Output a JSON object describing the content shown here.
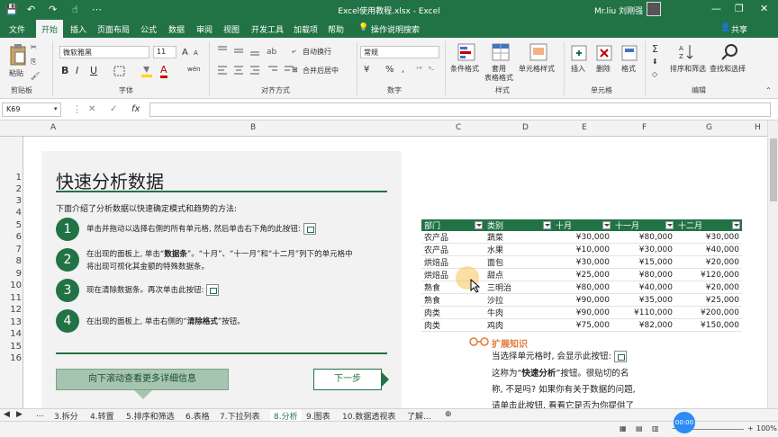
{
  "window": {
    "title": "Excel使用教程.xlsx - Excel",
    "user": "Mr.liu 刘刚强",
    "minimize": "—",
    "restore": "❐",
    "close": "✕"
  },
  "ribbon_tabs": [
    "文件",
    "开始",
    "插入",
    "页面布局",
    "公式",
    "数据",
    "审阅",
    "视图",
    "开发工具",
    "加载项",
    "帮助",
    "操作说明搜索"
  ],
  "ribbon": {
    "clipboard": {
      "paste": "粘贴",
      "label": "剪贴板"
    },
    "font": {
      "name": "微软雅黑",
      "size": "11",
      "label": "字体",
      "bold": "B",
      "italic": "I",
      "underline": "U",
      "grow": "A",
      "shrink": "A",
      "fontcolor": "A",
      "wen": "wén"
    },
    "alignment": {
      "wrap": "自动换行",
      "merge": "合并后居中",
      "label": "对齐方式"
    },
    "number": {
      "format": "常规",
      "label": "数字",
      "percent": "%",
      "comma": ",",
      "currency": "¥"
    },
    "styles": {
      "conditional": "条件格式",
      "table": "套用\n表格格式",
      "cell_styles": "单元格样式",
      "label": "样式"
    },
    "cells": {
      "insert": "插入",
      "delete": "删除",
      "format": "格式",
      "label": "单元格"
    },
    "editing": {
      "sort": "排序和筛选",
      "find": "查找和选择",
      "label": "编辑",
      "sum": "Σ"
    }
  },
  "formula_bar": {
    "namebox": "K69",
    "fx": "fx",
    "cancel": "✕",
    "enter": "✓",
    "value": ""
  },
  "columns": [
    "A",
    "B",
    "C",
    "D",
    "E",
    "F",
    "G",
    "H"
  ],
  "rows": [
    "1",
    "2",
    "3",
    "4",
    "5",
    "6",
    "7",
    "8",
    "9",
    "10",
    "11",
    "12",
    "13",
    "14",
    "15",
    "16"
  ],
  "panel": {
    "title": "快速分析数据",
    "intro": "下面介绍了分析数据以快速确定模式和趋势的方法:",
    "steps": [
      {
        "num": "1",
        "text": "单击并拖动以选择右侧的所有单元格, 然后单击右下角的此按钮:"
      },
      {
        "num": "2",
        "pre": "在出现的面板上, 单击“",
        "bold": "数据条",
        "post": "”。“十月”、“十一月”和“十二月”列下的单元格中将出现可视化其金额的特殊数据条。"
      },
      {
        "num": "3",
        "text": "现在清除数据条。再次单击此按钮:"
      },
      {
        "num": "4",
        "pre": "在出现的面板上, 单击右侧的“",
        "bold": "清除格式",
        "post": "”按钮。"
      }
    ],
    "scroll_button": "向下滚动查看更多详细信息",
    "next_button": "下一步"
  },
  "table": {
    "headers": [
      "部门",
      "类别",
      "十月",
      "十一月",
      "十二月"
    ],
    "rows": [
      [
        "农产品",
        "蔬菜",
        "¥30,000",
        "¥80,000",
        "¥30,000"
      ],
      [
        "农产品",
        "水果",
        "¥10,000",
        "¥30,000",
        "¥40,000"
      ],
      [
        "烘焙品",
        "面包",
        "¥30,000",
        "¥15,000",
        "¥20,000"
      ],
      [
        "烘焙品",
        "甜点",
        "¥25,000",
        "¥80,000",
        "¥120,000"
      ],
      [
        "熟食",
        "三明治",
        "¥80,000",
        "¥40,000",
        "¥20,000"
      ],
      [
        "熟食",
        "沙拉",
        "¥90,000",
        "¥35,000",
        "¥25,000"
      ],
      [
        "肉类",
        "牛肉",
        "¥90,000",
        "¥110,000",
        "¥200,000"
      ],
      [
        "肉类",
        "鸡肉",
        "¥75,000",
        "¥82,000",
        "¥150,000"
      ]
    ]
  },
  "knowledge": {
    "title": "扩展知识",
    "line1": "当选择单元格时, 会显示此按钮:",
    "line2_pre": "这称为“",
    "line2_bold": "快速分析",
    "line2_post": "”按钮。很贴切的名",
    "line3": "称, 不是吗? 如果你有关于数据的问题,",
    "line4": "请单击此按钮, 看看它是否为你提供了"
  },
  "sheet_tabs": [
    "...",
    "3.拆分",
    "4.转置",
    "5.排序和筛选",
    "6.表格",
    "7.下拉列表",
    "8.分析",
    "9.图表",
    "10.数据透视表",
    "了解..."
  ],
  "active_sheet": "8.分析",
  "timer": "00:00",
  "zoom": "100%",
  "accent": "#217346"
}
